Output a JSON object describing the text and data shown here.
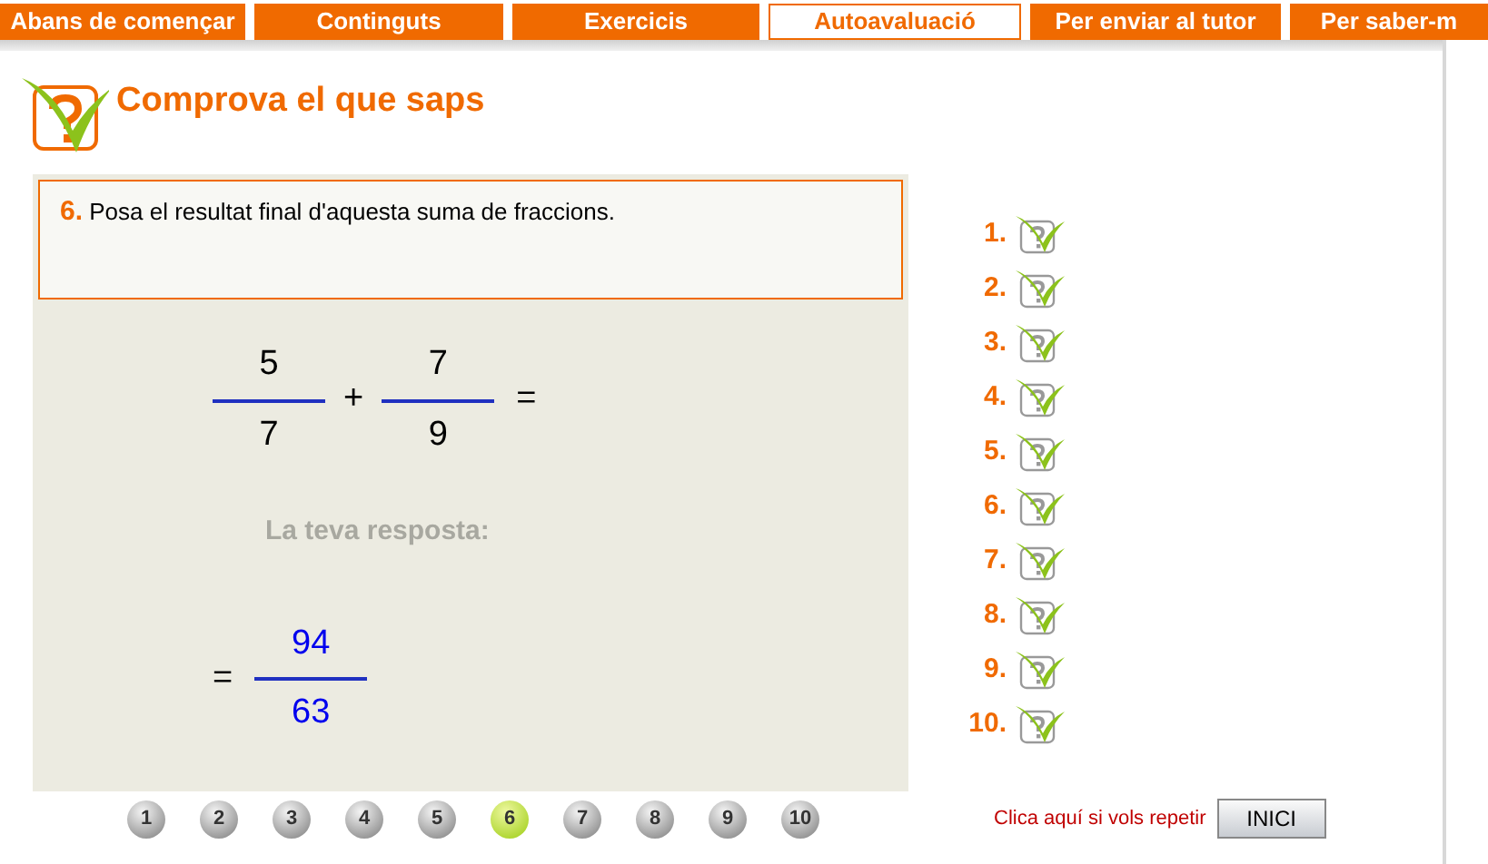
{
  "tabs": [
    {
      "label": "Abans de començar",
      "selected": false
    },
    {
      "label": "Continguts",
      "selected": false
    },
    {
      "label": "Exercicis",
      "selected": false
    },
    {
      "label": "Autoavaluació",
      "selected": true
    },
    {
      "label": "Per enviar al tutor",
      "selected": false
    },
    {
      "label": "Per saber-m",
      "selected": false
    }
  ],
  "heading": "Comprova el que saps",
  "question": {
    "number": "6.",
    "text": "Posa el resultat final d'aquesta suma de fraccions."
  },
  "expression": {
    "fractions": [
      {
        "numerator": "5",
        "denominator": "7"
      },
      {
        "numerator": "7",
        "denominator": "9"
      }
    ],
    "operator": "+",
    "equals": "="
  },
  "answer_label": "La teva resposta:",
  "answer": {
    "equals": "=",
    "numerator": "94",
    "denominator": "63"
  },
  "question_list": [
    {
      "label": "1."
    },
    {
      "label": "2."
    },
    {
      "label": "3."
    },
    {
      "label": "4."
    },
    {
      "label": "5."
    },
    {
      "label": "6."
    },
    {
      "label": "7."
    },
    {
      "label": "8."
    },
    {
      "label": "9."
    },
    {
      "label": "10."
    }
  ],
  "pager": [
    {
      "label": "1",
      "selected": false
    },
    {
      "label": "2",
      "selected": false
    },
    {
      "label": "3",
      "selected": false
    },
    {
      "label": "4",
      "selected": false
    },
    {
      "label": "5",
      "selected": false
    },
    {
      "label": "6",
      "selected": true
    },
    {
      "label": "7",
      "selected": false
    },
    {
      "label": "8",
      "selected": false
    },
    {
      "label": "9",
      "selected": false
    },
    {
      "label": "10",
      "selected": false
    }
  ],
  "repeat_text": "Clica aquí si vols repetir",
  "repeat_button": "INICI"
}
